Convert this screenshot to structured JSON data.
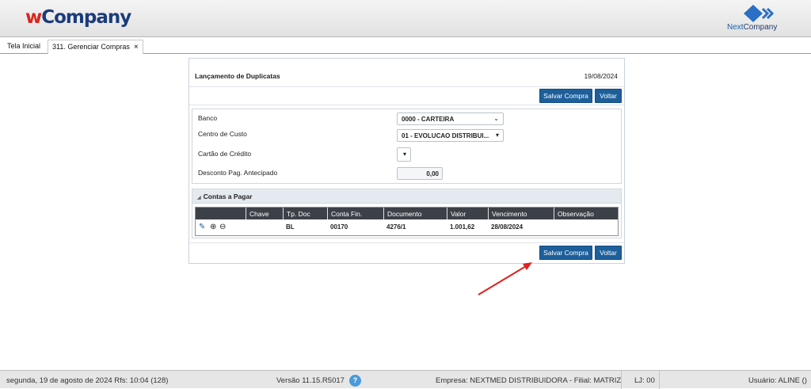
{
  "header": {
    "logo_w": "w",
    "logo_company": "Company",
    "brand_right_next": "Next",
    "brand_right_company": "Company"
  },
  "tabs": [
    {
      "label": "Tela Inicial"
    },
    {
      "label": "311. Gerenciar Compras",
      "close": "×"
    }
  ],
  "panel": {
    "title": "Lançamento de Duplicatas",
    "date": "19/08/2024",
    "save_label": "Salvar Compra",
    "back_label": "Voltar"
  },
  "form": {
    "banco_label": "Banco",
    "banco_value": "0000 - CARTEIRA",
    "centro_label": "Centro de Custo",
    "centro_value": "01 - EVOLUCAO DISTRIBUI...",
    "cartao_label": "Cartão de Crédito",
    "desconto_label": "Desconto Pag. Antecipado",
    "desconto_value": "0,00"
  },
  "contas": {
    "title": "Contas a Pagar",
    "columns": [
      "Chave",
      "Tp. Doc",
      "Conta Fin.",
      "Documento",
      "Valor",
      "Vencimento",
      "Observação"
    ],
    "rows": [
      {
        "chave": "",
        "tpdoc": "BL",
        "conta": "00170",
        "documento": "4276/1",
        "valor": "1.001,62",
        "vencimento": "28/08/2024",
        "obs": ""
      }
    ]
  },
  "status": {
    "date": "segunda, 19 de agosto de 2024  Rfs: 10:04 (128)",
    "version": "Versão 11.15.R5017",
    "help": "?",
    "empresa": "Empresa: NEXTMED DISTRIBUIDORA - Filial: MATRIZ",
    "lj": "LJ: 00",
    "usuario": "Usuário: ALINE ()"
  },
  "colors": {
    "primary_button": "#1d5f9a",
    "table_header": "#3c4148",
    "annotation_arrow": "#e02020"
  }
}
